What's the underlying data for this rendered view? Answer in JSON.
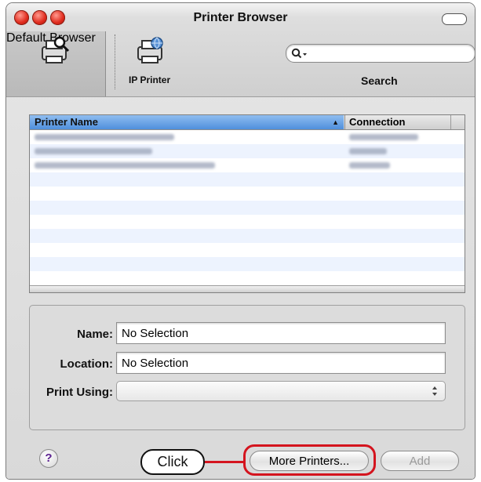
{
  "window": {
    "title": "Printer Browser"
  },
  "toolbar": {
    "default_browser_label": "Default Browser",
    "ip_printer_label": "IP Printer",
    "search_label": "Search",
    "search_placeholder": ""
  },
  "printer_list": {
    "columns": [
      "Printer Name",
      "Connection"
    ],
    "sort_indicator": "▲",
    "rows": [
      {
        "name": "",
        "connection": ""
      },
      {
        "name": "",
        "connection": ""
      },
      {
        "name": "",
        "connection": ""
      }
    ]
  },
  "details": {
    "name_label": "Name:",
    "name_value": "No Selection",
    "location_label": "Location:",
    "location_value": "No Selection",
    "print_using_label": "Print Using:",
    "print_using_value": ""
  },
  "footer": {
    "help_glyph": "?",
    "callout_label": "Click",
    "more_printers_label": "More Printers...",
    "add_label": "Add"
  },
  "colors": {
    "highlight_ring": "#d4141e",
    "header_selected": "#4f8fdc"
  },
  "icons": [
    "printer-search-icon",
    "ip-printer-icon",
    "search-icon",
    "help-icon"
  ]
}
